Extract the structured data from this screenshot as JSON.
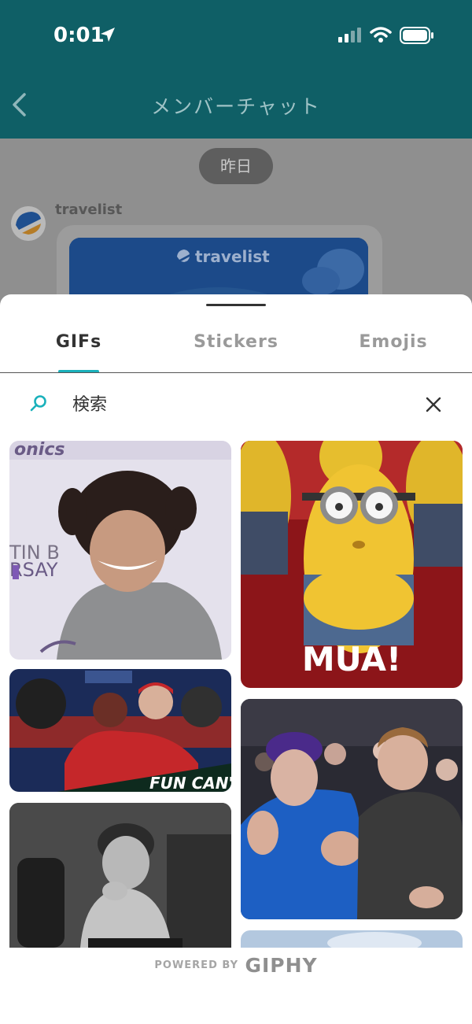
{
  "status_bar": {
    "time": "0:01",
    "location_icon": "location-arrow-icon",
    "signal_icon": "cellular-signal-icon",
    "wifi_icon": "wifi-icon",
    "battery_icon": "battery-icon"
  },
  "header": {
    "title": "メンバーチャット",
    "back_icon": "chevron-left-icon",
    "background_color": "#0f5f66"
  },
  "chat": {
    "date_separator": "昨日",
    "sender_name": "travelist",
    "card_logo_text": "travelist"
  },
  "gif_picker": {
    "tabs": [
      {
        "label": "GIFs",
        "active": true
      },
      {
        "label": "Stickers",
        "active": false
      },
      {
        "label": "Emojis",
        "active": false
      }
    ],
    "accent_color": "#1ab1bb",
    "search": {
      "placeholder": "検索",
      "search_icon": "search-icon",
      "clear_icon": "close-icon"
    },
    "gifs": [
      {
        "column": "left",
        "description": "smiling woman with curly updo",
        "caption": ""
      },
      {
        "column": "left",
        "description": "baseball players hugging in dugout",
        "caption": "FUN CAN'T LO"
      },
      {
        "column": "left",
        "description": "black and white child pondering",
        "caption": ""
      },
      {
        "column": "right",
        "description": "minion blowing kiss",
        "caption": "MUA!"
      },
      {
        "column": "right",
        "description": "man in blue hoodie clapping courtside",
        "caption": ""
      },
      {
        "column": "right",
        "description": "sky landscape (partially visible)",
        "caption": ""
      }
    ],
    "footer": {
      "powered_by": "POWERED BY",
      "brand": "GIPHY"
    }
  }
}
